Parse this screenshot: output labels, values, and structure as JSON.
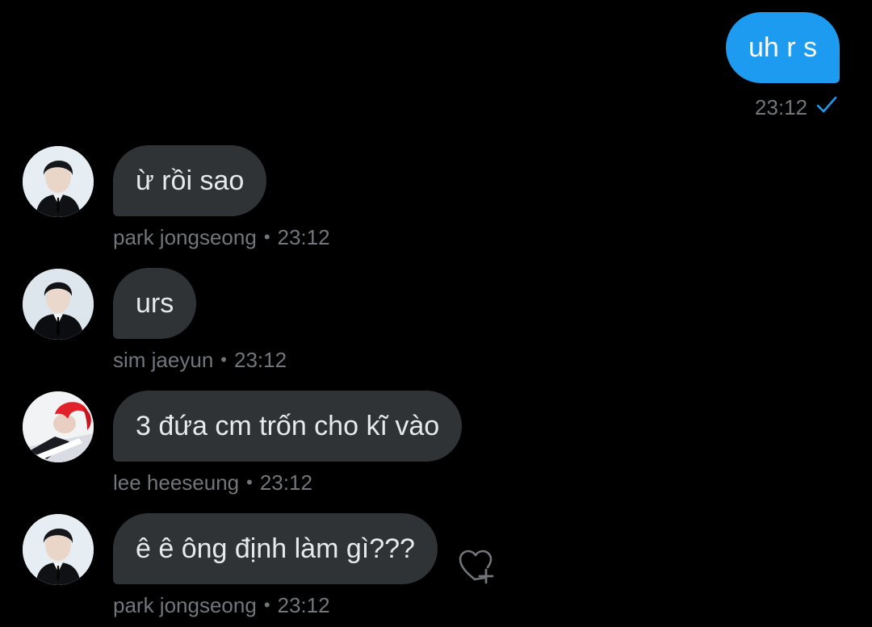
{
  "accent_color": "#1d9bf0",
  "messages": [
    {
      "direction": "outgoing",
      "text": "uh r s",
      "time": "23:12",
      "status_icon": "checkmark-icon"
    },
    {
      "direction": "incoming",
      "text": "ừ rồi sao",
      "sender": "park jongseong",
      "time": "23:12",
      "avatar": "avatar-black-hair"
    },
    {
      "direction": "incoming",
      "text": "urs",
      "sender": "sim jaeyun",
      "time": "23:12",
      "avatar": "avatar-black-suit"
    },
    {
      "direction": "incoming",
      "text": "3 đứa cm trốn cho kĩ vào",
      "sender": "lee heeseung",
      "time": "23:12",
      "avatar": "avatar-red-hair"
    },
    {
      "direction": "incoming",
      "text": "ê ê ông định làm gì???",
      "sender": "park jongseong",
      "time": "23:12",
      "avatar": "avatar-black-hair",
      "reaction_button_icon": "heart-plus-icon"
    }
  ],
  "separator": "•"
}
